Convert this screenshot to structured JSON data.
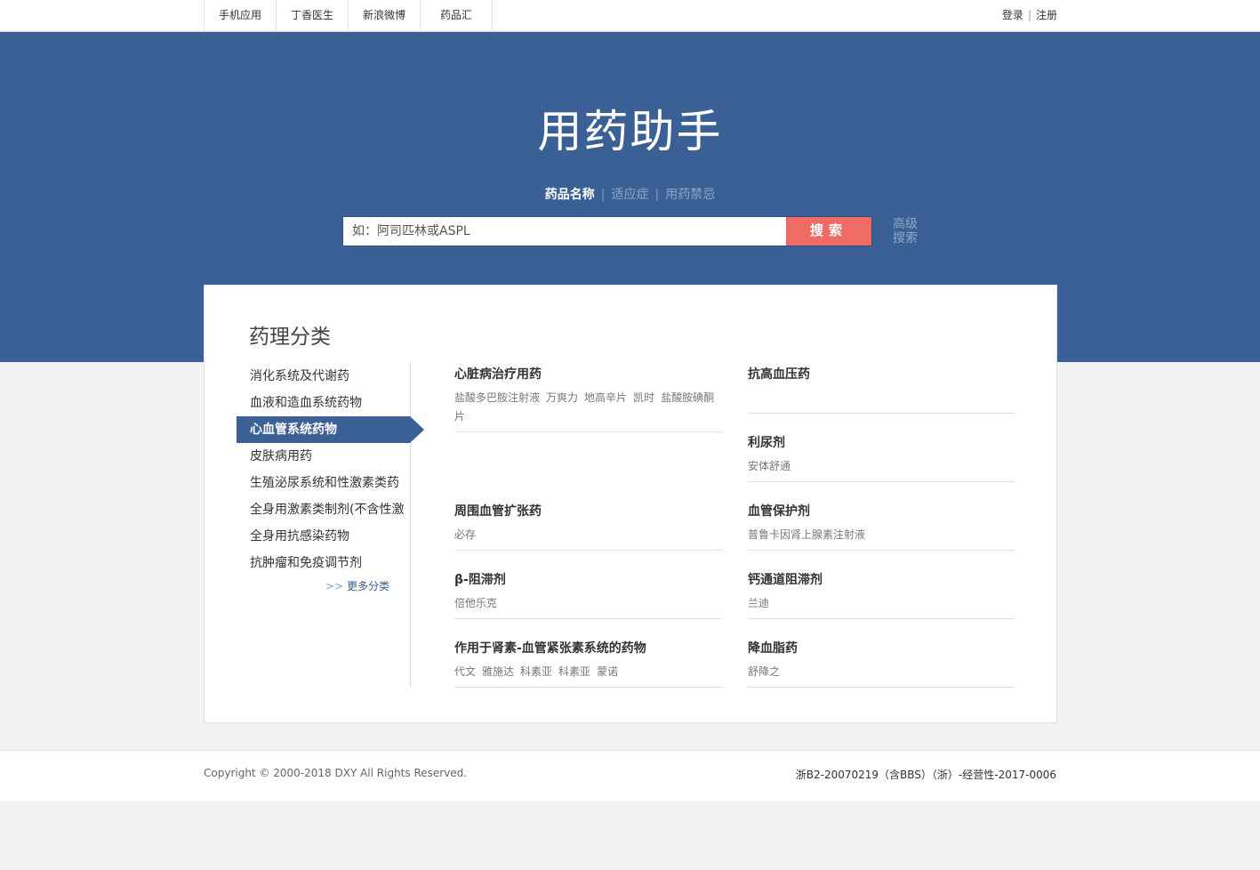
{
  "topnav": {
    "items": [
      "手机应用",
      "丁香医生",
      "新浪微博",
      "药品汇"
    ],
    "login": "登录",
    "divider": "|",
    "register": "注册"
  },
  "hero": {
    "logo_text": "用药助手",
    "tabs": [
      "药品名称",
      "适应症",
      "用药禁忌"
    ],
    "tab_divider": "|",
    "active_tab_index": 0,
    "search_placeholder": "如：阿司匹林或ASPL",
    "search_button": "搜索",
    "advanced_search": "高级搜索"
  },
  "panel": {
    "title": "药理分类",
    "categories": [
      "消化系统及代谢药",
      "血液和造血系统药物",
      "心血管系统药物",
      "皮肤病用药",
      "生殖泌尿系统和性激素类药",
      "全身用激素类制剂(不含性激",
      "全身用抗感染药物",
      "抗肿瘤和免疫调节剂"
    ],
    "active_category_index": 2,
    "more_arrows": ">>",
    "more_label": "更多分类",
    "subcategories": [
      {
        "name": "心脏病治疗用药",
        "drugs": [
          "盐酸多巴胺注射液",
          "万爽力",
          "地高辛片",
          "凯时",
          "盐酸胺碘酮片"
        ]
      },
      {
        "name": "抗高血压药",
        "drugs": []
      },
      {
        "name": "利尿剂",
        "drugs": [
          "安体舒通"
        ]
      },
      {
        "name": "周围血管扩张药",
        "drugs": [
          "必存"
        ]
      },
      {
        "name": "血管保护剂",
        "drugs": [
          "普鲁卡因肾上腺素注射液"
        ]
      },
      {
        "name": "β-阻滞剂",
        "drugs": [
          "倍他乐克"
        ]
      },
      {
        "name": "钙通道阻滞剂",
        "drugs": [
          "兰迪"
        ]
      },
      {
        "name": "作用于肾素-血管紧张素系统的药物",
        "drugs": [
          "代文",
          "雅施达",
          "科素亚",
          "科素亚",
          "蒙诺"
        ]
      },
      {
        "name": "降血脂药",
        "drugs": [
          "舒降之"
        ]
      }
    ]
  },
  "footer": {
    "copyright": "Copyright © 2000-2018 DXY All Rights Reserved.",
    "icp": "浙B2-20070219（含BBS）（浙）-经营性-2017-0006"
  },
  "colors": {
    "brand_blue": "#3a6096",
    "search_button": "#ee6b66",
    "page_bg": "#f2f2f2"
  }
}
